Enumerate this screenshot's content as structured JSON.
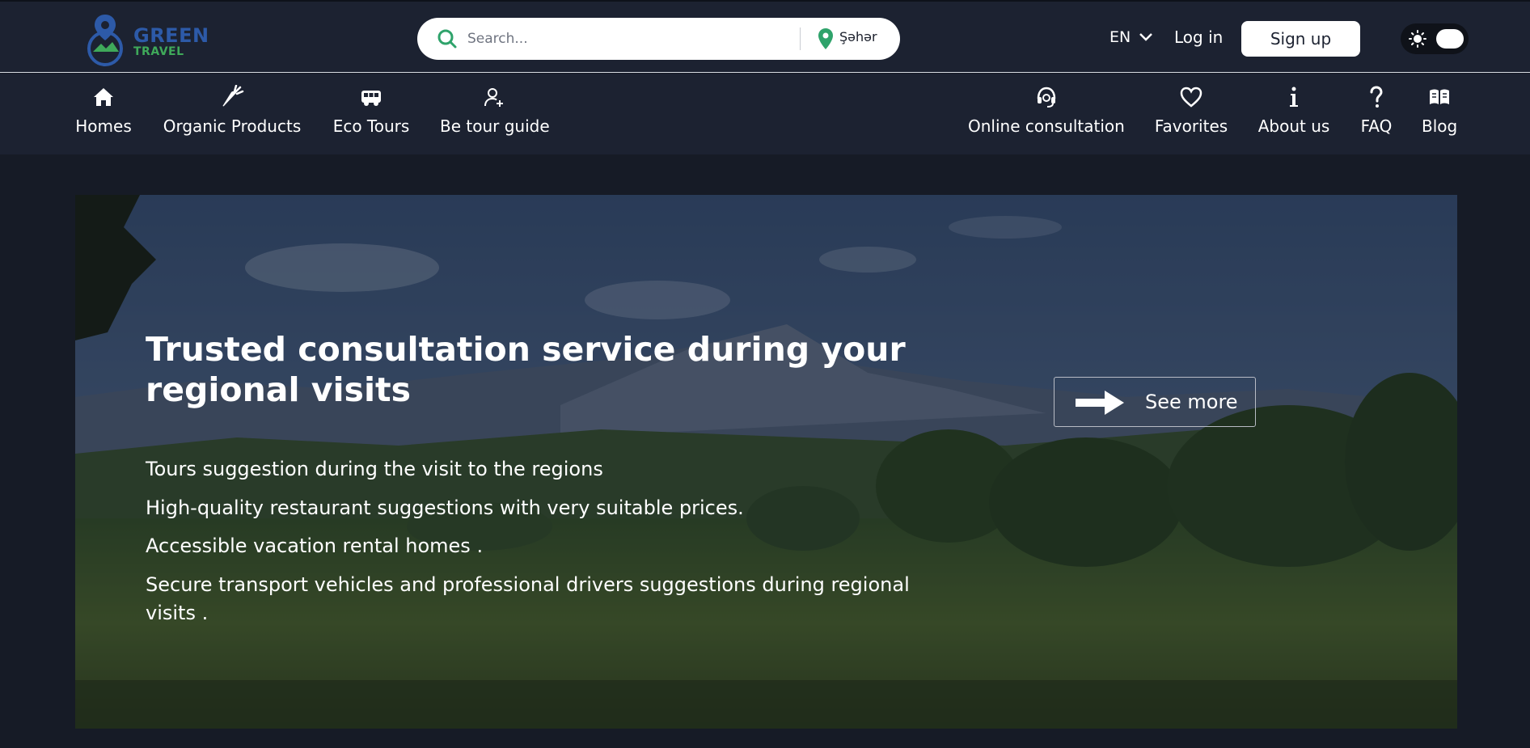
{
  "header": {
    "logo": {
      "line1": "GREEN",
      "line2": "TRAVEL"
    },
    "search": {
      "placeholder": "Search...",
      "city": "Şəhər"
    },
    "lang": "EN",
    "login": "Log in",
    "signup": "Sign up"
  },
  "nav": {
    "left": [
      {
        "label": "Homes",
        "icon": "home-icon"
      },
      {
        "label": "Organic Products",
        "icon": "carrot-icon"
      },
      {
        "label": "Eco Tours",
        "icon": "bus-icon"
      },
      {
        "label": "Be tour guide",
        "icon": "user-plus-icon"
      }
    ],
    "right": [
      {
        "label": "Online consultation",
        "icon": "headset-icon"
      },
      {
        "label": "Favorites",
        "icon": "heart-icon"
      },
      {
        "label": "About us",
        "icon": "info-icon"
      },
      {
        "label": "FAQ",
        "icon": "question-icon"
      },
      {
        "label": "Blog",
        "icon": "book-icon"
      }
    ]
  },
  "hero": {
    "title": "Trusted consultation service during your regional visits",
    "features": [
      "Tours suggestion during the visit to the regions",
      "High-quality restaurant suggestions with very suitable prices.",
      "Accessible vacation rental homes .",
      "Secure transport vehicles and professional drivers suggestions during regional visits ."
    ],
    "cta": "See more"
  },
  "colors": {
    "header_bg": "#1c2231",
    "page_bg": "#161b26",
    "accent_green": "#2fa36b",
    "logo_blue": "#2d5aa8"
  }
}
